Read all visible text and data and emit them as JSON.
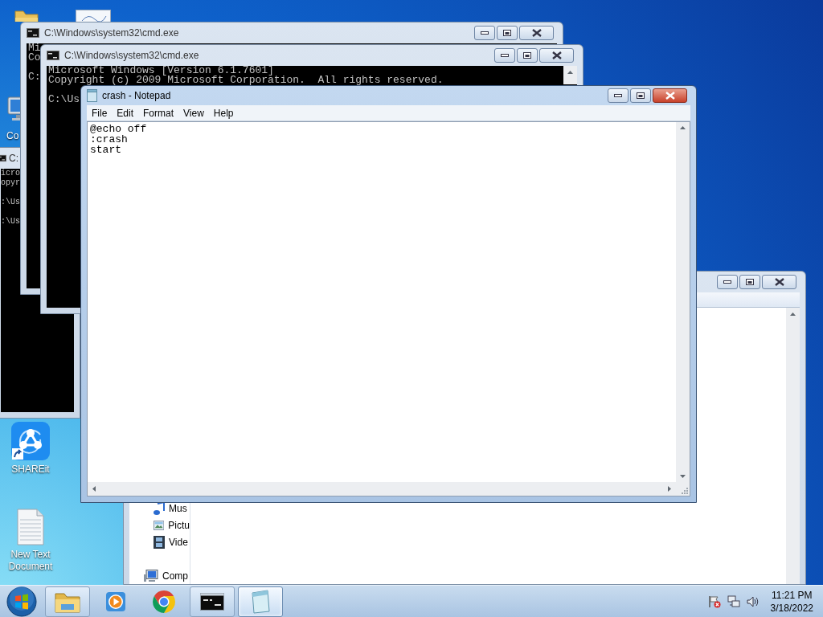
{
  "desktop_icons": [
    {
      "kind": "computer",
      "label": "Co"
    },
    {
      "kind": "shareit",
      "label": "SHAREit"
    },
    {
      "kind": "text-file",
      "label": "New Text Document"
    }
  ],
  "explorer_window": {
    "focused": false,
    "nav_tree": [
      {
        "children": [
          {
            "kind": "music",
            "label": "Mus"
          },
          {
            "kind": "pictures",
            "label": "Pictu"
          },
          {
            "kind": "videos",
            "label": "Vide"
          }
        ]
      },
      {
        "kind": "computer",
        "label": "Comp"
      }
    ]
  },
  "cmd_windows": [
    {
      "title": "C:",
      "focused": false,
      "paragraphs": [
        [
          "icro",
          "opyr"
        ],
        [
          ":\\Us"
        ],
        [
          ":\\Us"
        ]
      ]
    },
    {
      "title": "C:\\Windows\\system32\\cmd.exe",
      "focused": false,
      "paragraphs": [
        [
          "Mi",
          "Co"
        ],
        [
          "C:"
        ]
      ]
    },
    {
      "title": "C:\\Windows\\system32\\cmd.exe",
      "focused": false,
      "paragraphs": [
        [
          "Microsoft Windows [Version 6.1.7601]",
          "Copyright (c) 2009 Microsoft Corporation.  All rights reserved."
        ],
        [
          "C:\\Us"
        ]
      ]
    }
  ],
  "notepad": {
    "title": "crash - Notepad",
    "focused": true,
    "menu": [
      "File",
      "Edit",
      "Format",
      "View",
      "Help"
    ],
    "text_lines": [
      "@echo off",
      ":crash",
      "start"
    ]
  },
  "taskbar": {
    "buttons": [
      {
        "kind": "folder",
        "open": true,
        "selected": false
      },
      {
        "kind": "media",
        "open": false,
        "selected": false
      },
      {
        "kind": "browser",
        "open": false,
        "selected": false
      },
      {
        "kind": "cmd",
        "open": true,
        "selected": false
      },
      {
        "kind": "notepad",
        "open": true,
        "selected": true
      }
    ],
    "clock": {
      "time": "11:21 PM",
      "date": "3/18/2022"
    }
  }
}
